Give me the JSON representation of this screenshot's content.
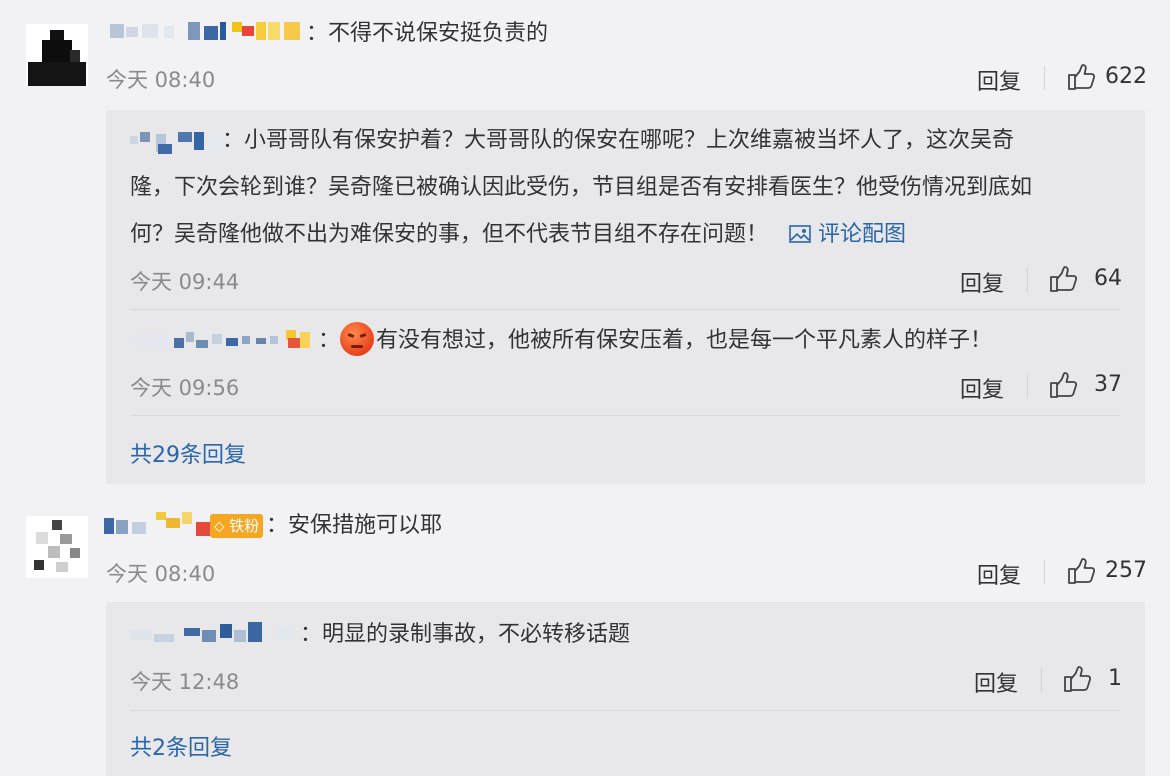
{
  "comments": [
    {
      "text": "不得不说保安挺负责的",
      "time": "今天 08:40",
      "reply_label": "回复",
      "likes": "622",
      "replies": [
        {
          "line1": "小哥哥队有保安护着？大哥哥队的保安在哪呢？上次维嘉被当坏人了，这次吴奇",
          "line2": "隆，下次会轮到谁？吴奇隆已被确认因此受伤，节目组是否有安排看医生？他受伤情况到底如",
          "line3": "何？吴奇隆他做不出为难保安的事，但不代表节目组不存在问题！",
          "image_link": "评论配图",
          "time": "今天 09:44",
          "reply_label": "回复",
          "likes": "64"
        },
        {
          "text": "有没有想过，他被所有保安压着，也是每一个平凡素人的样子！",
          "time": "今天 09:56",
          "reply_label": "回复",
          "likes": "37"
        }
      ],
      "more_replies": "共29条回复"
    },
    {
      "badge": "铁粉",
      "text": "安保措施可以耶",
      "time": "今天 08:40",
      "reply_label": "回复",
      "likes": "257",
      "replies": [
        {
          "text": "明显的录制事故，不必转移话题",
          "time": "今天 12:48",
          "reply_label": "回复",
          "likes": "1"
        }
      ],
      "more_replies": "共2条回复"
    }
  ],
  "colors": {
    "background": "#f2f2f5",
    "reply_box": "#e8e8eb",
    "link": "#2a66a8",
    "time": "#8a8a8a",
    "badge": "#f5a623"
  },
  "icons": [
    "avatar-image",
    "thumbs-up-icon",
    "image-icon",
    "angry-emoji-icon",
    "fan-badge-icon"
  ]
}
